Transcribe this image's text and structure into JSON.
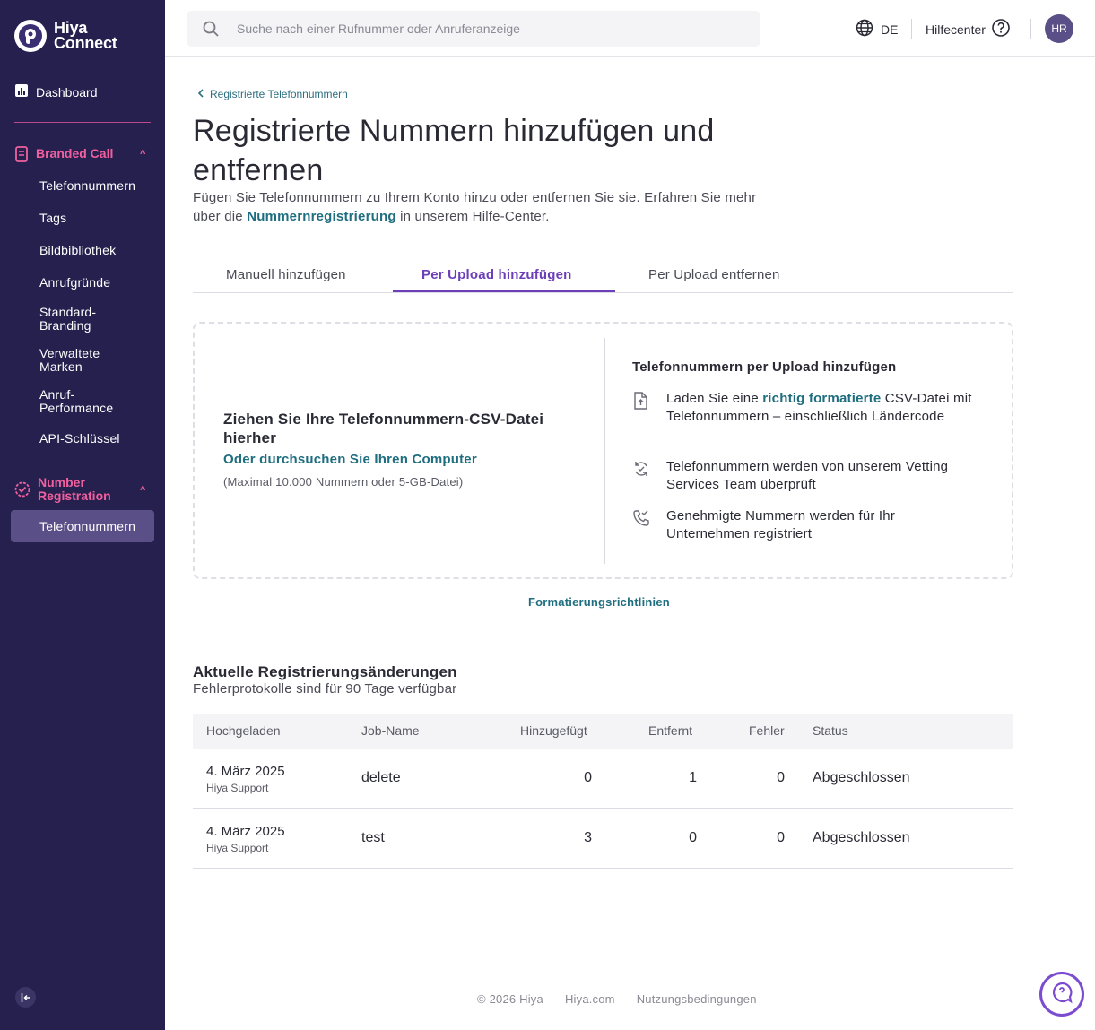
{
  "brand": {
    "line1": "Hiya",
    "line2": "Connect"
  },
  "sidebar": {
    "dashboard": "Dashboard",
    "branded_call": {
      "label": "Branded Call",
      "items": [
        "Telefonnummern",
        "Tags",
        "Bildbibliothek",
        "Anrufgründe",
        "Standard-Branding",
        "Verwaltete Marken",
        "Anruf-Performance",
        "API-Schlüssel"
      ]
    },
    "number_registration": {
      "label": "Number Registration",
      "items": [
        "Telefonnummern"
      ]
    }
  },
  "header": {
    "search_placeholder": "Suche nach einer Rufnummer oder Anruferanzeige",
    "language": "DE",
    "help": "Hilfecenter",
    "avatar_initials": "HR"
  },
  "main": {
    "back_link": "Registrierte Telefonnummern",
    "title": "Registrierte Nummern hinzufügen und entfernen",
    "desc_before": "Fügen Sie Telefonnummern zu Ihrem Konto hinzu oder entfernen Sie sie. Erfahren Sie mehr über die ",
    "desc_link": "Nummernregistrierung",
    "desc_after": " in unserem Hilfe-Center.",
    "tabs": [
      "Manuell hinzufügen",
      "Per Upload hinzufügen",
      "Per Upload entfernen"
    ],
    "active_tab": 1,
    "dropzone": {
      "title": "Ziehen Sie Ihre Telefonnummern-CSV-Datei hierher",
      "browse": "Oder durchsuchen Sie Ihren Computer",
      "limit": "(Maximal 10.000 Nummern oder 5-GB-Datei)",
      "right_title": "Telefonnummern per Upload hinzufügen",
      "step1_before": "Laden Sie eine ",
      "step1_link": "richtig formatierte",
      "step1_after": " CSV-Datei mit Telefonnummern – einschließlich Ländercode",
      "step2": "Telefonnummern werden von unserem Vetting Services Team überprüft",
      "step3": "Genehmigte Nummern werden für Ihr Unternehmen registriert"
    },
    "format_link": "Formatierungsrichtlinien",
    "recent": {
      "title": "Aktuelle Registrierungsänderungen",
      "subtitle": "Fehlerprotokolle sind für 90 Tage verfügbar",
      "columns": [
        "Hochgeladen",
        "Job-Name",
        "Hinzugefügt",
        "Entfernt",
        "Fehler",
        "Status"
      ],
      "rows": [
        {
          "date": "4. März 2025",
          "by": "Hiya Support",
          "job": "delete",
          "added": "0",
          "removed": "1",
          "errors": "0",
          "status": "Abgeschlossen"
        },
        {
          "date": "4. März 2025",
          "by": "Hiya Support",
          "job": "test",
          "added": "3",
          "removed": "0",
          "errors": "0",
          "status": "Abgeschlossen"
        }
      ]
    }
  },
  "footer": {
    "copyright": "© 2026 Hiya",
    "site": "Hiya.com",
    "terms": "Nutzungsbedingungen"
  }
}
